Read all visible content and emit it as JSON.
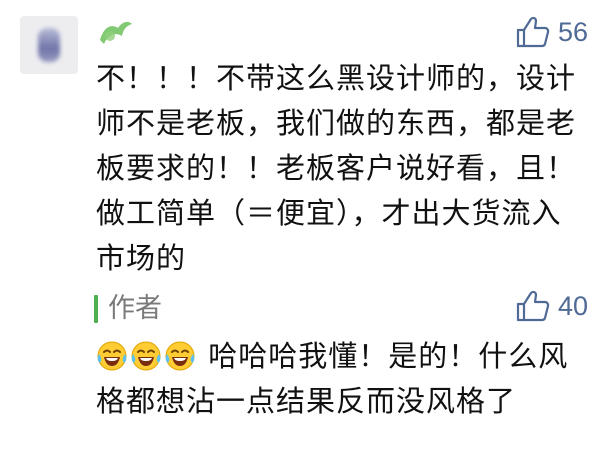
{
  "comment": {
    "likes": "56",
    "text": "不！！！不带这么黑设计师的，设计师不是老板，我们做的东西，都是老板要求的！！老板客户说好看，且！做工简单（＝便宜），才出大货流入市场的"
  },
  "reply": {
    "author_label": "作者",
    "likes": "40",
    "emoji": [
      "laughing-tears-emoji",
      "laughing-tears-emoji",
      "laughing-tears-emoji"
    ],
    "text": "哈哈哈我懂！是的！什么风格都想沾一点结果反而没风格了"
  },
  "colors": {
    "like_icon": "#4f6a95",
    "author_bar": "#4caf50",
    "nickname": "#6bbf59"
  }
}
